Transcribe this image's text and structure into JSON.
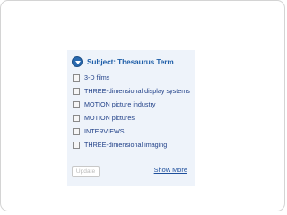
{
  "panel": {
    "title": "Subject: Thesaurus Term",
    "icon": "chevron-down-circle-icon",
    "accent_color": "#1e5ea8",
    "background_color": "#eef3fa"
  },
  "terms": [
    {
      "label": "3-D films",
      "checked": false
    },
    {
      "label": "THREE-dimensional display systems",
      "checked": false
    },
    {
      "label": "MOTION picture industry",
      "checked": false
    },
    {
      "label": "MOTION pictures",
      "checked": false
    },
    {
      "label": "INTERVIEWS",
      "checked": false
    },
    {
      "label": "THREE-dimensional imaging",
      "checked": false
    }
  ],
  "actions": {
    "update_label": "Update",
    "show_more_label": "Show More"
  }
}
